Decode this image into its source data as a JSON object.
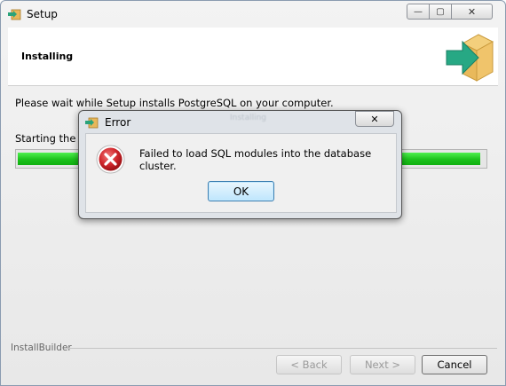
{
  "window": {
    "title": "Setup",
    "icon": "setup-box-icon",
    "controls": {
      "minimize": "—",
      "maximize": "▢",
      "close": "✕"
    }
  },
  "header": {
    "title": "Installing",
    "icon": "package-arrow-icon"
  },
  "content": {
    "message": "Please wait while Setup installs PostgreSQL on your computer.",
    "status": "Starting the da",
    "progress_fraction": 0.99
  },
  "footer": {
    "brand": "InstallBuilder",
    "back_label": "< Back",
    "next_label": "Next >",
    "cancel_label": "Cancel"
  },
  "dialog": {
    "title": "Error",
    "ghost_title": "Installing",
    "close": "✕",
    "message": "Failed to load SQL modules into the database cluster.",
    "ok_label": "OK",
    "icon": "error-icon"
  },
  "colors": {
    "progress": "#1cc21c",
    "error_red": "#d0262b",
    "ok_border": "#3c7fb1"
  }
}
